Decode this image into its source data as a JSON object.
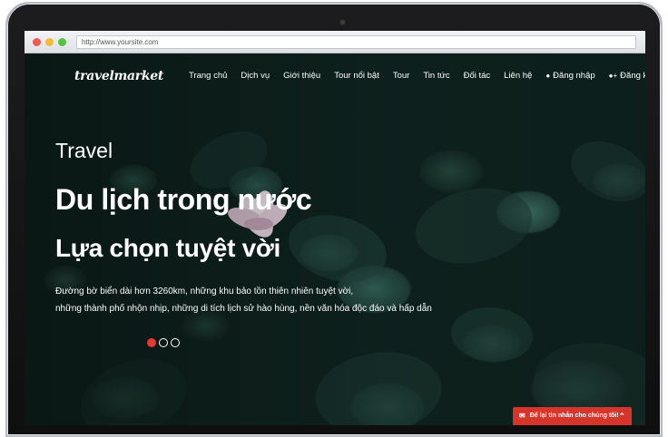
{
  "browser": {
    "url": "http://www.yoursite.com"
  },
  "site": {
    "logo": "travelmarket",
    "nav": [
      {
        "label": "Trang chủ",
        "icon": ""
      },
      {
        "label": "Dịch vụ",
        "icon": ""
      },
      {
        "label": "Giới thiệu",
        "icon": ""
      },
      {
        "label": "Tour nổi bật",
        "icon": ""
      },
      {
        "label": "Tour",
        "icon": ""
      },
      {
        "label": "Tin tức",
        "icon": ""
      },
      {
        "label": "Đối tác",
        "icon": ""
      },
      {
        "label": "Liên hệ",
        "icon": ""
      },
      {
        "label": "Đăng nhập",
        "icon": "user-icon"
      },
      {
        "label": "Đăng ký",
        "icon": "user-plus-icon"
      }
    ]
  },
  "hero": {
    "kicker": "Travel",
    "title": "Du lịch trong nước",
    "subtitle": "Lựa chọn tuyệt vời",
    "description_line1": "Đường bờ biển dài hơn 3260km, những khu bảo tồn thiên nhiên tuyệt vời,",
    "description_line2": "những thành phố nhộn nhịp, những di tích lịch sử hào hùng, nền văn hóa độc đáo và hấp dẫn",
    "carousel": {
      "count": 3,
      "active_index": 0
    }
  },
  "chat": {
    "label": "Để lại tin nhắn cho chúng tôi!",
    "icon": "envelope-icon",
    "toggle_icon": "chevron-up-icon"
  },
  "colors": {
    "accent": "#e53935",
    "chat_bg": "#d7342c",
    "hero_bg": "#0f2420"
  }
}
